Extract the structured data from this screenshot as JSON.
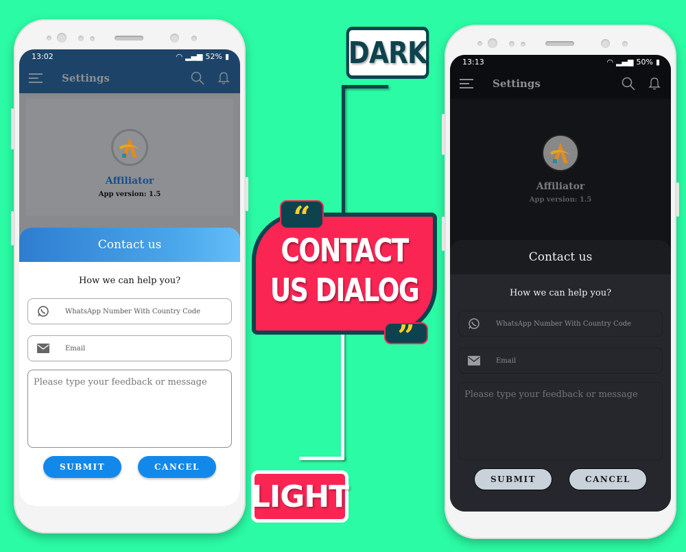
{
  "labels": {
    "dark": "DARK",
    "light": "LIGHT",
    "center_line1": "CONTACT",
    "center_line2": "US DIALOG",
    "quote_open": "“",
    "quote_close": "”"
  },
  "colors": {
    "background": "#2bfba4",
    "accent_red": "#fb2554",
    "accent_teal": "#0d434f",
    "quote_yellow": "#ffcf2b",
    "light_button": "#1289ea",
    "dark_button": "#c9d1da"
  },
  "light_phone": {
    "status": {
      "time": "13:02",
      "battery": "52%"
    },
    "appbar": {
      "title": "Settings"
    },
    "about": {
      "app_name": "Affiliator",
      "version": "App version: 1.5"
    },
    "dialog": {
      "title": "Contact us",
      "subtitle": "How we can help you?",
      "whatsapp_placeholder": "WhatsApp Number With Country Code",
      "email_placeholder": "Email",
      "message_placeholder": "Please type your feedback or message",
      "submit_label": "SUBMIT",
      "cancel_label": "CANCEL"
    }
  },
  "dark_phone": {
    "status": {
      "time": "13:13",
      "battery": "50%"
    },
    "appbar": {
      "title": "Settings"
    },
    "about": {
      "app_name": "Affiliator",
      "version": "App version: 1.5"
    },
    "dialog": {
      "title": "Contact us",
      "subtitle": "How we can help you?",
      "whatsapp_placeholder": "WhatsApp Number With Country Code",
      "email_placeholder": "Email",
      "message_placeholder": "Please type your feedback or message",
      "submit_label": "SUBMIT",
      "cancel_label": "CANCEL"
    }
  }
}
